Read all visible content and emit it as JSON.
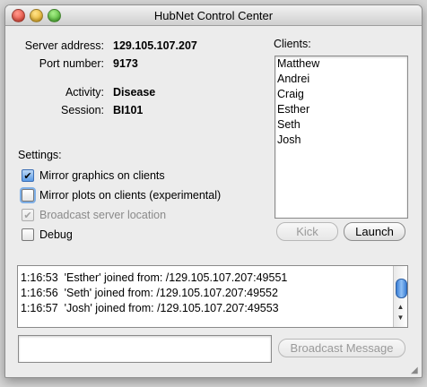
{
  "window": {
    "title": "HubNet Control Center"
  },
  "server": {
    "address_label": "Server address:",
    "address": "129.105.107.207",
    "port_label": "Port number:",
    "port": "9173",
    "activity_label": "Activity:",
    "activity": "Disease",
    "session_label": "Session:",
    "session": "BI101"
  },
  "settings": {
    "label": "Settings:",
    "items": [
      {
        "label": "Mirror graphics on clients",
        "checked": true,
        "enabled": true
      },
      {
        "label": "Mirror plots on clients (experimental)",
        "checked": false,
        "enabled": true
      },
      {
        "label": "Broadcast server location",
        "checked": true,
        "enabled": false
      },
      {
        "label": "Debug",
        "checked": false,
        "enabled": true
      }
    ]
  },
  "clients": {
    "label": "Clients:",
    "items": [
      "Matthew",
      "Andrei",
      "Craig",
      "Esther",
      "Seth",
      "Josh"
    ]
  },
  "buttons": {
    "kick": "Kick",
    "launch": "Launch",
    "broadcast": "Broadcast Message"
  },
  "log": {
    "lines": [
      "1:16:53  'Esther' joined from: /129.105.107.207:49551",
      "1:16:56  'Seth' joined from: /129.105.107.207:49552",
      "1:16:57  'Josh' joined from: /129.105.107.207:49553"
    ]
  },
  "message": {
    "value": ""
  },
  "icons": {
    "check": "checkmark-icon",
    "up": "scroll-up-icon",
    "down": "scroll-down-icon"
  },
  "colors": {
    "accent": "#3b7fd6",
    "window_bg": "#ececec"
  }
}
